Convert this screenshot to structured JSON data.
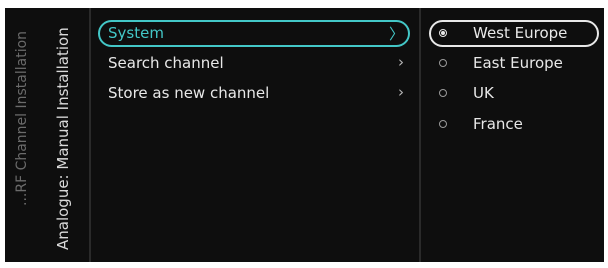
{
  "breadcrumb": {
    "parent": "...RF Channel Installation",
    "current": "Analogue: Manual Installation"
  },
  "menu": {
    "items": [
      {
        "label": "System",
        "selected": true
      },
      {
        "label": "Search channel",
        "selected": false
      },
      {
        "label": "Store as new channel",
        "selected": false
      }
    ],
    "chevron_icon": "chevron-right-icon"
  },
  "options": {
    "items": [
      {
        "label": "West Europe",
        "checked": true
      },
      {
        "label": "East Europe",
        "checked": false
      },
      {
        "label": "UK",
        "checked": false
      },
      {
        "label": "France",
        "checked": false
      }
    ],
    "radio_icon": "radio-icon"
  },
  "colors": {
    "background": "#0e0e0e",
    "accent": "#43c7c7",
    "text": "#e8e8e8"
  }
}
